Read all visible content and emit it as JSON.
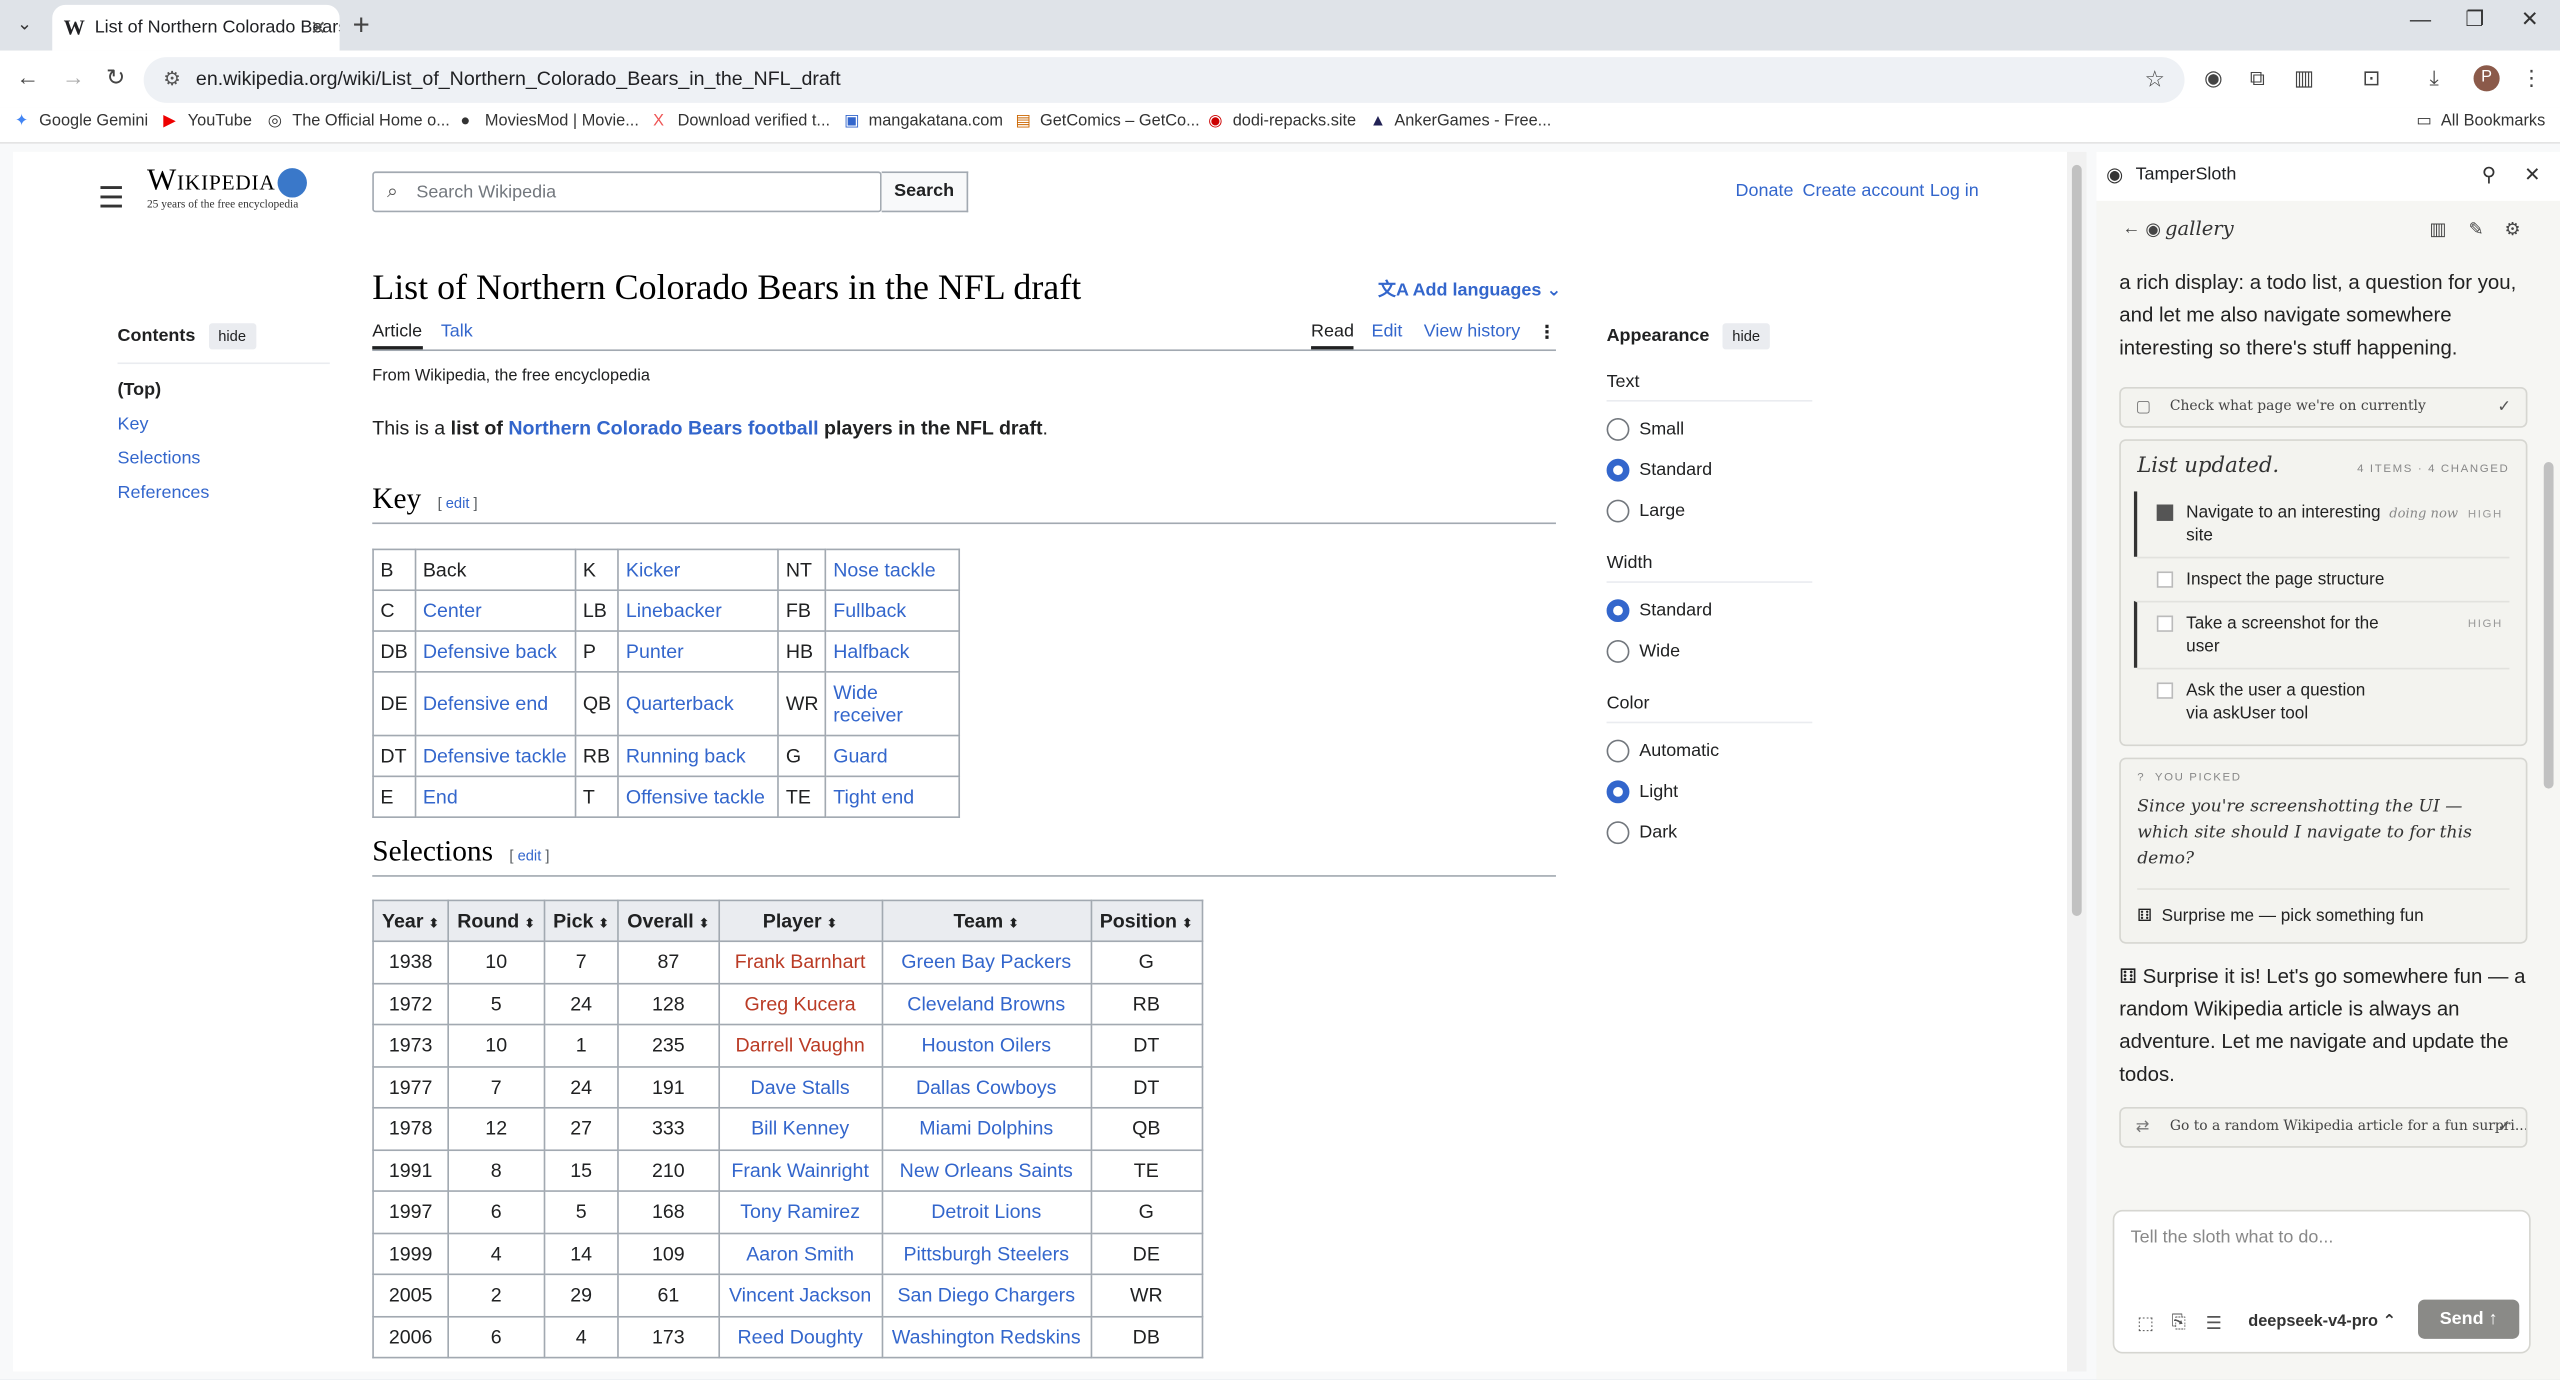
{
  "browser": {
    "tab_title": "List of Northern Colorado Bears",
    "tab_favicon": "W",
    "url": "en.wikipedia.org/wiki/List_of_Northern_Colorado_Bears_in_the_NFL_draft",
    "bookmarks": [
      {
        "label": "Google Gemini",
        "icon": "✦"
      },
      {
        "label": "YouTube",
        "icon": "▶"
      },
      {
        "label": "The Official Home o...",
        "icon": "◎"
      },
      {
        "label": "MoviesMod | Movie...",
        "icon": "●"
      },
      {
        "label": "Download verified t...",
        "icon": "X"
      },
      {
        "label": "mangakatana.com",
        "icon": "▣"
      },
      {
        "label": "GetComics – GetCo...",
        "icon": "▤"
      },
      {
        "label": "dodi-repacks.site",
        "icon": "◉"
      },
      {
        "label": "AnkerGames - Free...",
        "icon": "▲"
      }
    ],
    "all_bookmarks": "All Bookmarks",
    "avatar_letter": "P"
  },
  "wiki": {
    "logo_text": "Wikipedia",
    "logo_tagline": "25 years of the free encyclopedia",
    "search_placeholder": "Search Wikipedia",
    "search_button": "Search",
    "donate": "Donate",
    "create_account": "Create account",
    "login": "Log in",
    "contents_label": "Contents",
    "hide": "hide",
    "toc": [
      "(Top)",
      "Key",
      "Selections",
      "References"
    ],
    "title": "List of Northern Colorado Bears in the NFL draft",
    "add_languages": "Add languages",
    "tab_article": "Article",
    "tab_talk": "Talk",
    "tab_read": "Read",
    "tab_edit": "Edit",
    "tab_history": "View history",
    "from": "From Wikipedia, the free encyclopedia",
    "intro_pre": "This is a ",
    "intro_b1": "list of ",
    "intro_link": "Northern Colorado Bears football",
    "intro_b2": " players in the NFL draft",
    "intro_post": ".",
    "key_heading": "Key",
    "selections_heading": "Selections",
    "edit": "edit",
    "key_rows": [
      [
        [
          "B",
          "Back",
          false
        ],
        [
          "K",
          "Kicker",
          true
        ],
        [
          "NT",
          "Nose tackle",
          true
        ]
      ],
      [
        [
          "C",
          "Center",
          true
        ],
        [
          "LB",
          "Linebacker",
          true
        ],
        [
          "FB",
          "Fullback",
          true
        ]
      ],
      [
        [
          "DB",
          "Defensive back",
          true
        ],
        [
          "P",
          "Punter",
          true
        ],
        [
          "HB",
          "Halfback",
          true
        ]
      ],
      [
        [
          "DE",
          "Defensive end",
          true
        ],
        [
          "QB",
          "Quarterback",
          true
        ],
        [
          "WR",
          "Wide receiver",
          true
        ]
      ],
      [
        [
          "DT",
          "Defensive tackle",
          true
        ],
        [
          "RB",
          "Running back",
          true
        ],
        [
          "G",
          "Guard",
          true
        ]
      ],
      [
        [
          "E",
          "End",
          true
        ],
        [
          "T",
          "Offensive tackle",
          true
        ],
        [
          "TE",
          "Tight end",
          true
        ]
      ]
    ],
    "sel_headers": [
      "Year",
      "Round",
      "Pick",
      "Overall",
      "Player",
      "Team",
      "Position"
    ],
    "sel_rows": [
      {
        "year": "1938",
        "round": "10",
        "pick": "7",
        "overall": "87",
        "player": "Frank Barnhart",
        "red": true,
        "team": "Green Bay Packers",
        "pos": "G"
      },
      {
        "year": "1972",
        "round": "5",
        "pick": "24",
        "overall": "128",
        "player": "Greg Kucera",
        "red": true,
        "team": "Cleveland Browns",
        "pos": "RB"
      },
      {
        "year": "1973",
        "round": "10",
        "pick": "1",
        "overall": "235",
        "player": "Darrell Vaughn",
        "red": true,
        "team": "Houston Oilers",
        "pos": "DT"
      },
      {
        "year": "1977",
        "round": "7",
        "pick": "24",
        "overall": "191",
        "player": "Dave Stalls",
        "red": false,
        "team": "Dallas Cowboys",
        "pos": "DT"
      },
      {
        "year": "1978",
        "round": "12",
        "pick": "27",
        "overall": "333",
        "player": "Bill Kenney",
        "red": false,
        "team": "Miami Dolphins",
        "pos": "QB"
      },
      {
        "year": "1991",
        "round": "8",
        "pick": "15",
        "overall": "210",
        "player": "Frank Wainright",
        "red": false,
        "team": "New Orleans Saints",
        "pos": "TE"
      },
      {
        "year": "1997",
        "round": "6",
        "pick": "5",
        "overall": "168",
        "player": "Tony Ramirez",
        "red": false,
        "team": "Detroit Lions",
        "pos": "G"
      },
      {
        "year": "1999",
        "round": "4",
        "pick": "14",
        "overall": "109",
        "player": "Aaron Smith",
        "red": false,
        "team": "Pittsburgh Steelers",
        "pos": "DE"
      },
      {
        "year": "2005",
        "round": "2",
        "pick": "29",
        "overall": "61",
        "player": "Vincent Jackson",
        "red": false,
        "team": "San Diego Chargers",
        "pos": "WR"
      },
      {
        "year": "2006",
        "round": "6",
        "pick": "4",
        "overall": "173",
        "player": "Reed Doughty",
        "red": false,
        "team": "Washington Redskins",
        "pos": "DB"
      }
    ],
    "appearance": {
      "title": "Appearance",
      "text_label": "Text",
      "text_options": [
        [
          "Small",
          false
        ],
        [
          "Standard",
          true
        ],
        [
          "Large",
          false
        ]
      ],
      "width_label": "Width",
      "width_options": [
        [
          "Standard",
          true
        ],
        [
          "Wide",
          false
        ]
      ],
      "color_label": "Color",
      "color_options": [
        [
          "Automatic",
          false
        ],
        [
          "Light",
          true
        ],
        [
          "Dark",
          false
        ]
      ]
    }
  },
  "panel": {
    "title": "TamperSloth",
    "session": "gallery",
    "msg1": "a rich display: a todo list, a question for you, and let me also navigate somewhere interesting so there's stuff happening.",
    "tool1": "Check what page we're on currently",
    "list_heading": "List updated.",
    "list_meta": "4 ITEMS · 4 CHANGED",
    "todos": [
      {
        "text": "Navigate to an interesting site",
        "state": "doing now",
        "prio": "HIGH",
        "active": true,
        "hl": true
      },
      {
        "text": "Inspect the page structure",
        "state": "",
        "prio": "",
        "active": false,
        "hl": false
      },
      {
        "text": "Take a screenshot for the user",
        "state": "",
        "prio": "HIGH",
        "active": false,
        "hl": true
      },
      {
        "text": "Ask the user a question via askUser tool",
        "state": "",
        "prio": "",
        "active": false,
        "hl": false
      }
    ],
    "picked_label": "YOU PICKED",
    "question": "Since you're screenshotting the UI — which site should I navigate to for this demo?",
    "answer": "Surprise me — pick something fun",
    "msg2": "Surprise it is! Let's go somewhere fun — a random Wikipedia article is always an adventure. Let me navigate and update the todos.",
    "tool2": "Go to a random Wikipedia article for a fun surpri...",
    "input_placeholder": "Tell the sloth what to do...",
    "model": "deepseek-v4-pro",
    "send": "Send"
  }
}
